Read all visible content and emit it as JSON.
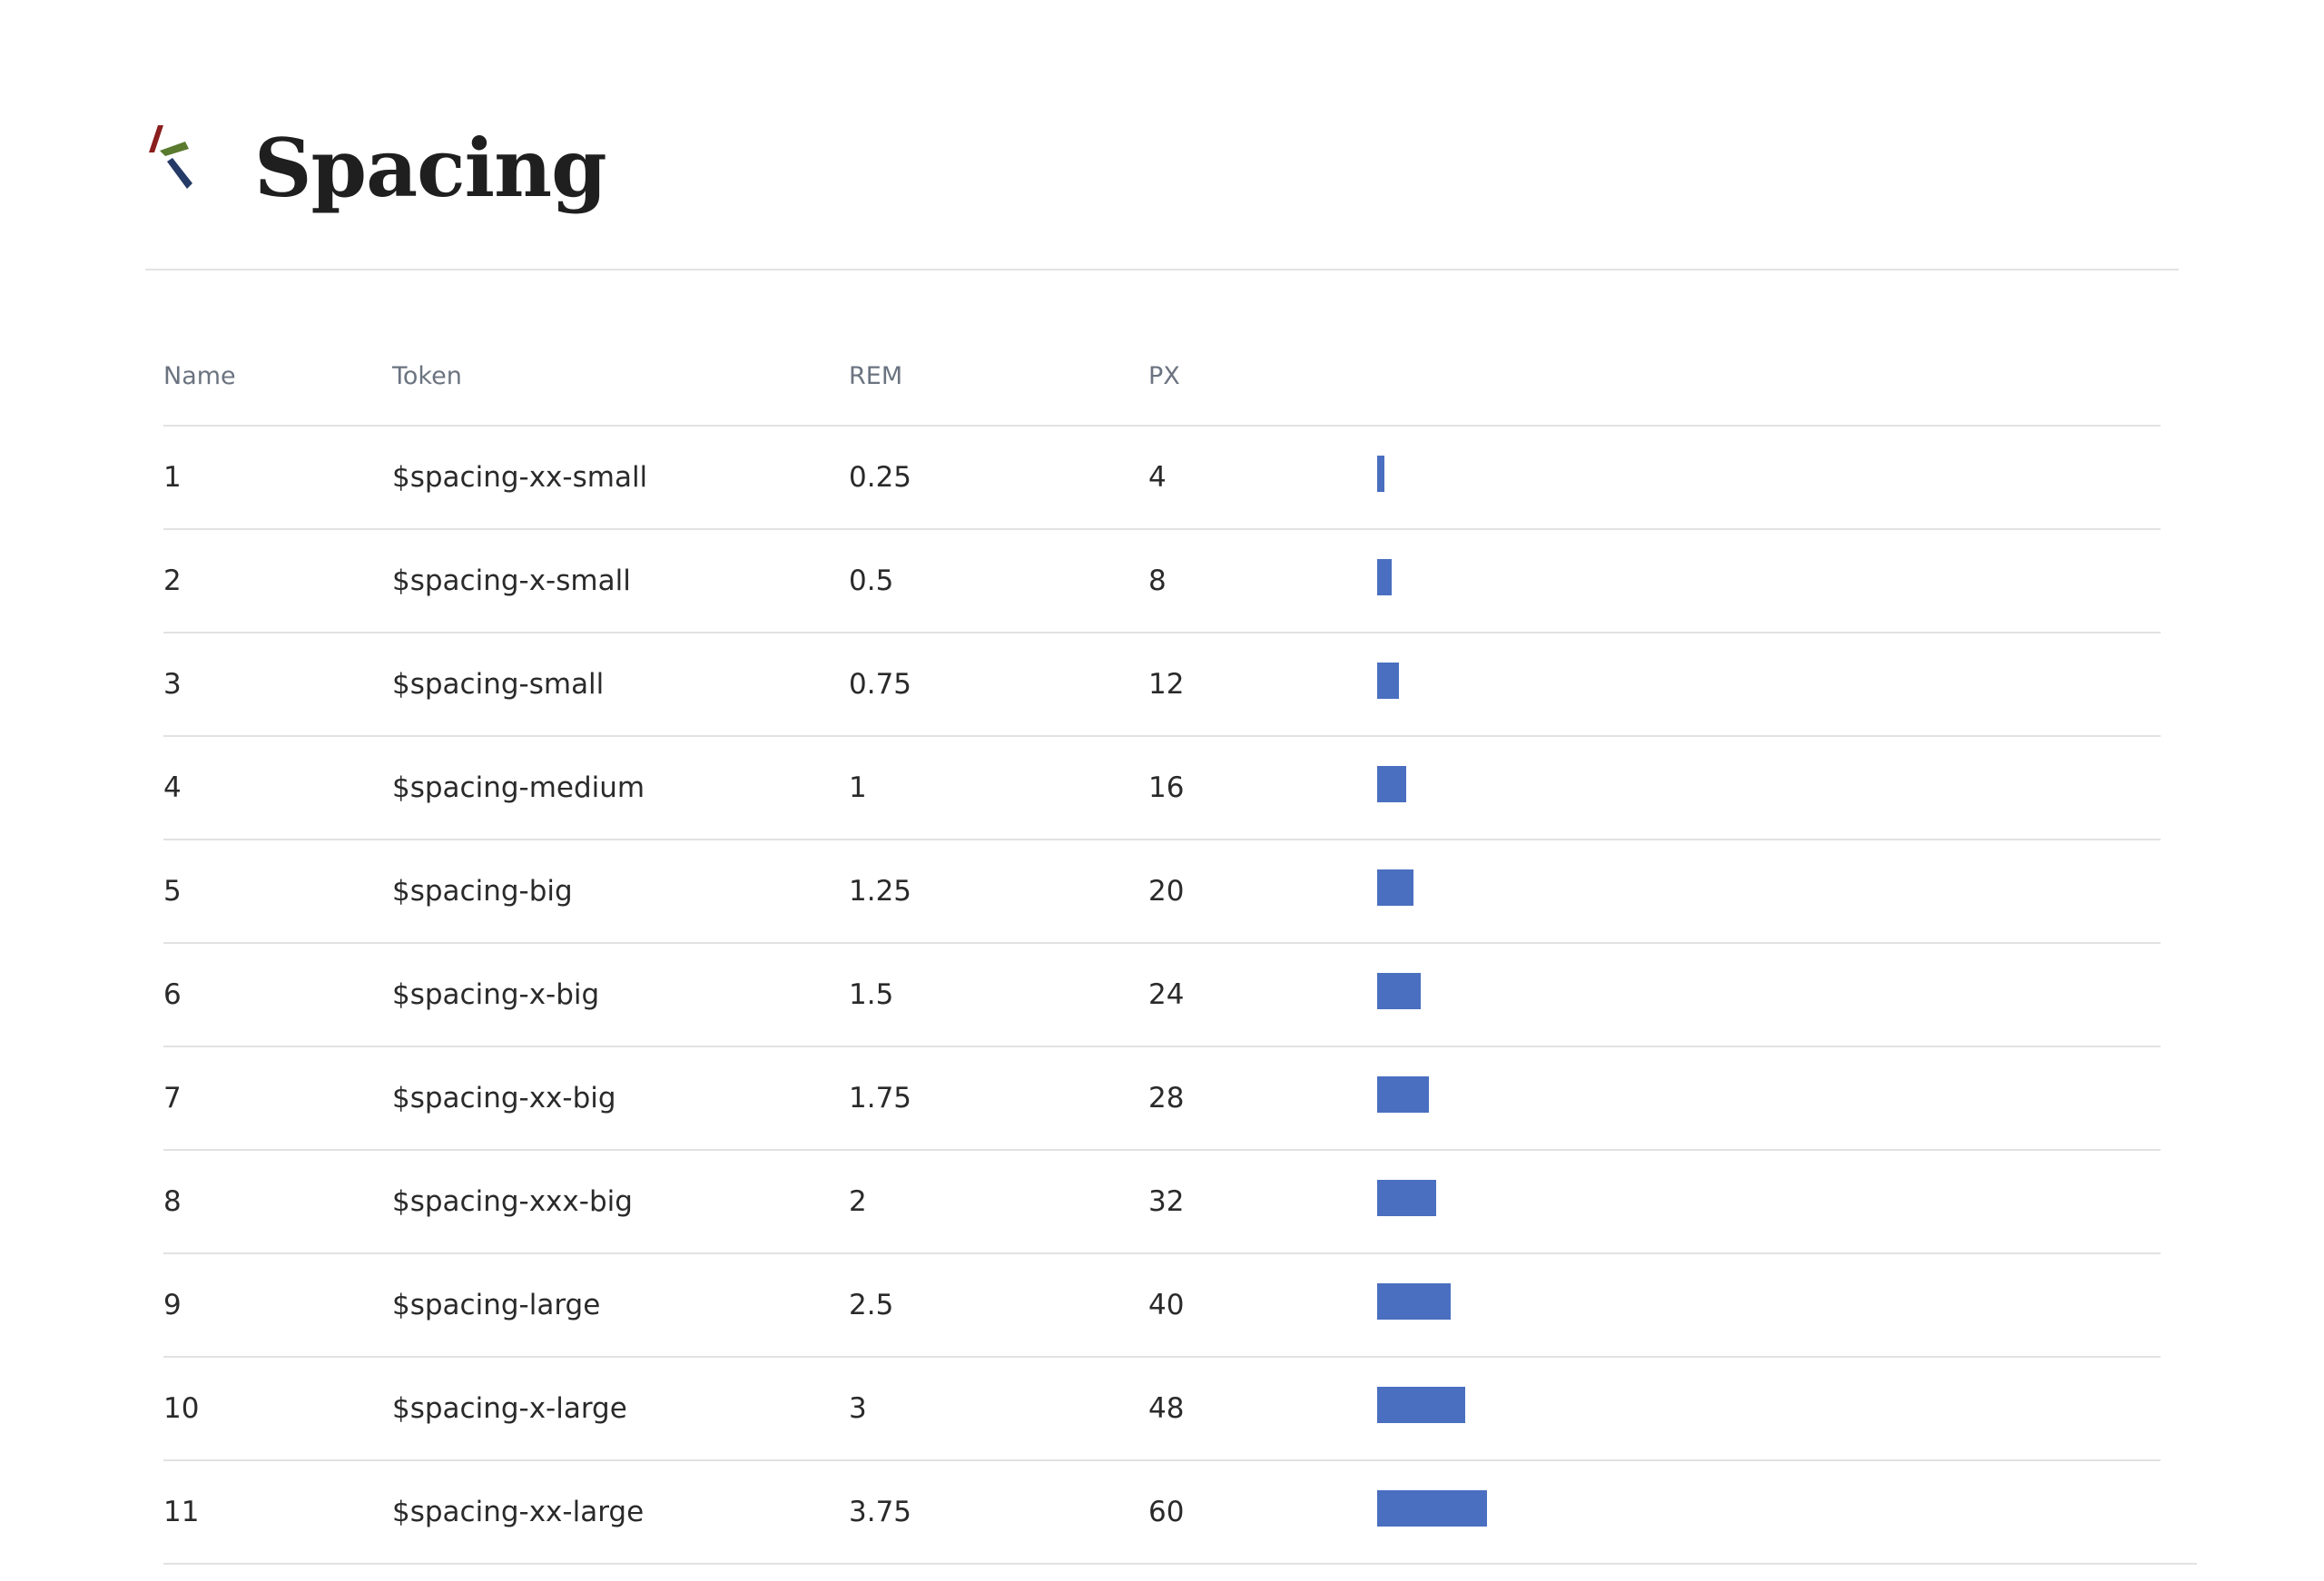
{
  "page": {
    "title": "Spacing",
    "logo_icon": "brand-logo-icon"
  },
  "colors": {
    "bar": "#4a6fc0",
    "rule": "#e2e2e2",
    "header_text": "#6b7380"
  },
  "table": {
    "columns": [
      "Name",
      "Token",
      "REM",
      "PX"
    ],
    "rows": [
      {
        "name": "1",
        "token": "$spacing-xx-small",
        "rem": "0.25",
        "px": "4"
      },
      {
        "name": "2",
        "token": "$spacing-x-small",
        "rem": "0.5",
        "px": "8"
      },
      {
        "name": "3",
        "token": "$spacing-small",
        "rem": "0.75",
        "px": "12"
      },
      {
        "name": "4",
        "token": "$spacing-medium",
        "rem": "1",
        "px": "16"
      },
      {
        "name": "5",
        "token": "$spacing-big",
        "rem": "1.25",
        "px": "20"
      },
      {
        "name": "6",
        "token": "$spacing-x-big",
        "rem": "1.5",
        "px": "24"
      },
      {
        "name": "7",
        "token": "$spacing-xx-big",
        "rem": "1.75",
        "px": "28"
      },
      {
        "name": "8",
        "token": "$spacing-xxx-big",
        "rem": "2",
        "px": "32"
      },
      {
        "name": "9",
        "token": "$spacing-large",
        "rem": "2.5",
        "px": "40"
      },
      {
        "name": "10",
        "token": "$spacing-x-large",
        "rem": "3",
        "px": "48"
      },
      {
        "name": "11",
        "token": "$spacing-xx-large",
        "rem": "3.75",
        "px": "60"
      }
    ]
  }
}
